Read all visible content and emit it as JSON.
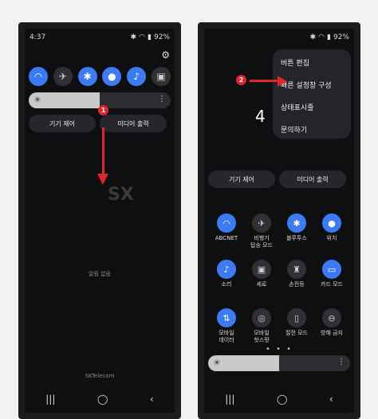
{
  "left": {
    "time": "4:37",
    "battery": "92%",
    "controls": {
      "device": "기기 제어",
      "media": "미디어 출력"
    },
    "no_notifications": "알림 없음",
    "carrier": "SKTelecom",
    "badge": "1"
  },
  "right": {
    "battery": "92%",
    "menu": [
      "버튼 편집",
      "빠른 설정창 구성",
      "상태표시줄",
      "문의하기"
    ],
    "clock_partial": "4",
    "controls": {
      "device": "기기 제어",
      "media": "미디어 출력"
    },
    "tiles": [
      {
        "label": "ABCNET",
        "icon": "wifi-icon",
        "on": true
      },
      {
        "label": "비행기\n탑승 모드",
        "icon": "airplane-icon",
        "on": false
      },
      {
        "label": "블루투스",
        "icon": "bluetooth-icon",
        "on": true
      },
      {
        "label": "위치",
        "icon": "location-icon",
        "on": true
      },
      {
        "label": "소리",
        "icon": "sound-icon",
        "on": true
      },
      {
        "label": "세로",
        "icon": "rotation-icon",
        "on": false
      },
      {
        "label": "손전등",
        "icon": "flashlight-icon",
        "on": false
      },
      {
        "label": "카드 모드",
        "icon": "card-icon",
        "on": true
      },
      {
        "label": "모바일\n데이터",
        "icon": "mobile-data-icon",
        "on": true
      },
      {
        "label": "모바일\n핫스팟",
        "icon": "hotspot-icon",
        "on": false
      },
      {
        "label": "절전 모드",
        "icon": "battery-saver-icon",
        "on": false
      },
      {
        "label": "방해 금지",
        "icon": "do-not-disturb-icon",
        "on": false
      }
    ],
    "badge": "2"
  },
  "watermark": "SX"
}
